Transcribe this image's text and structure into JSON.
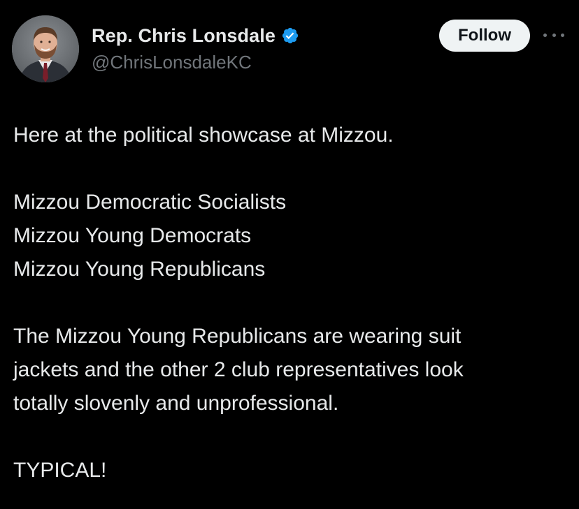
{
  "author": {
    "display_name": "Rep. Chris Lonsdale",
    "handle": "@ChrisLonsdaleKC",
    "verified": true,
    "verified_color": "#1d9bf0",
    "avatar_icon": "profile-photo"
  },
  "actions": {
    "follow_label": "Follow",
    "more_icon": "more-horizontal-icon"
  },
  "tweet": {
    "lines": [
      "Here at the political showcase at Mizzou.",
      "Mizzou Democratic Socialists",
      "Mizzou Young Democrats",
      "Mizzou Young Republicans",
      "The Mizzou Young Republicans are wearing suit",
      "jackets and the other 2 club representatives look",
      "totally slovenly and unprofessional.",
      "TYPICAL!"
    ]
  },
  "theme": {
    "background": "#000000",
    "text": "#e7e9ea",
    "secondary_text": "#71767b",
    "button_bg": "#eff3f4"
  }
}
